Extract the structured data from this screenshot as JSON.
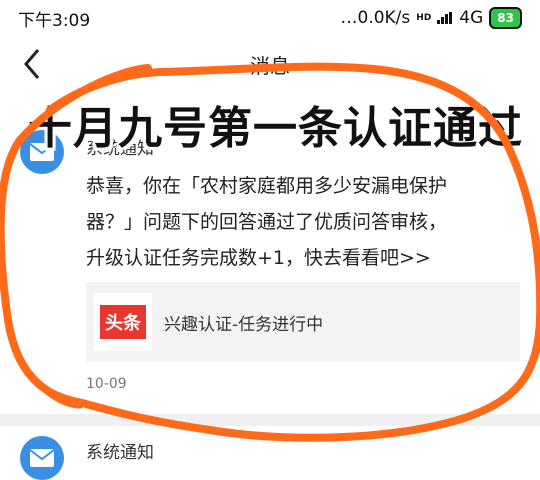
{
  "status": {
    "time": "下午3:09",
    "speed": "…0.0K/s",
    "network": "4G",
    "hd": "HD",
    "battery": "83"
  },
  "nav": {
    "title": "消息"
  },
  "overlay": {
    "caption": "十月九号第一条认证通过"
  },
  "messages": [
    {
      "sender": "系统通知",
      "lines": [
        "恭喜，你在「农村家庭都用多少安漏电保护",
        "器？」问题下的回答通过了优质问答审核，",
        "升级认证任务完成数+1，快去看看吧>>"
      ],
      "card": {
        "logo": "头条",
        "text": "兴趣认证-任务进行中"
      },
      "date": "10-09"
    },
    {
      "sender": "系统通知"
    }
  ],
  "colors": {
    "accent": "#3b8fe3",
    "scribble": "#ff6a1a",
    "logo": "#e8372e",
    "battery": "#2fc44a"
  }
}
